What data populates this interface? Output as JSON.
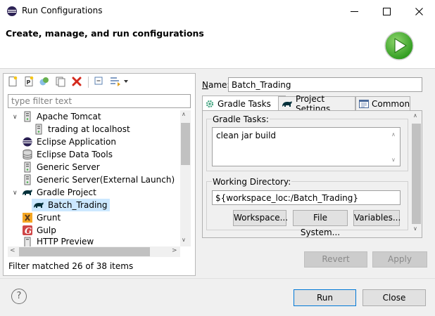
{
  "window": {
    "title": "Run Configurations",
    "controls": {
      "minimize": "—",
      "maximize": "☐",
      "close": "✕"
    }
  },
  "header": {
    "title": "Create, manage, and run configurations"
  },
  "left": {
    "filter": {
      "placeholder": "type filter text",
      "value": ""
    },
    "tree": [
      {
        "label": "Apache Tomcat",
        "icon": "tomcat-server-icon",
        "level": 0,
        "expanded": true
      },
      {
        "label": "trading at localhost",
        "icon": "server-config-icon",
        "level": 1
      },
      {
        "label": "Eclipse Application",
        "icon": "eclipse-icon",
        "level": 0
      },
      {
        "label": "Eclipse Data Tools",
        "icon": "database-icon",
        "level": 0
      },
      {
        "label": "Generic Server",
        "icon": "server-icon",
        "level": 0
      },
      {
        "label": "Generic Server(External Launch)",
        "icon": "server-icon",
        "level": 0
      },
      {
        "label": "Gradle Project",
        "icon": "gradle-icon",
        "level": 0,
        "expanded": true
      },
      {
        "label": "Batch_Trading",
        "icon": "gradle-icon",
        "level": 1,
        "selected": true
      },
      {
        "label": "Grunt",
        "icon": "grunt-icon",
        "level": 0
      },
      {
        "label": "Gulp",
        "icon": "gulp-icon",
        "level": 0
      },
      {
        "label": "HTTP Preview",
        "icon": "server-icon",
        "level": 0
      }
    ],
    "status": "Filter matched 26 of 38 items"
  },
  "right": {
    "name_label": "Name:",
    "name_value": "Batch_Trading",
    "tabs": [
      {
        "label": "Gradle Tasks",
        "icon": "gradle-tasks-icon",
        "active": true
      },
      {
        "label": "Project Settings",
        "icon": "gradle-icon"
      },
      {
        "label": "Common",
        "icon": "common-tab-icon"
      }
    ],
    "gradle_tasks_label": "Gradle Tasks:",
    "gradle_tasks_value": "clean jar build",
    "working_dir_label": "Working Directory:",
    "working_dir_value": "${workspace_loc:/Batch_Trading}",
    "workspace_button": "Workspace...",
    "filesystem_button": "File System...",
    "variables_button": "Variables...",
    "revert_button": "Revert",
    "apply_button": "Apply"
  },
  "footer": {
    "help_label": "?",
    "run_button": "Run",
    "close_button": "Close"
  },
  "colors": {
    "selection": "#cce8ff",
    "run_green": "#3cab2a",
    "delete_red": "#d4291c",
    "default_button_border": "#0078d7"
  }
}
